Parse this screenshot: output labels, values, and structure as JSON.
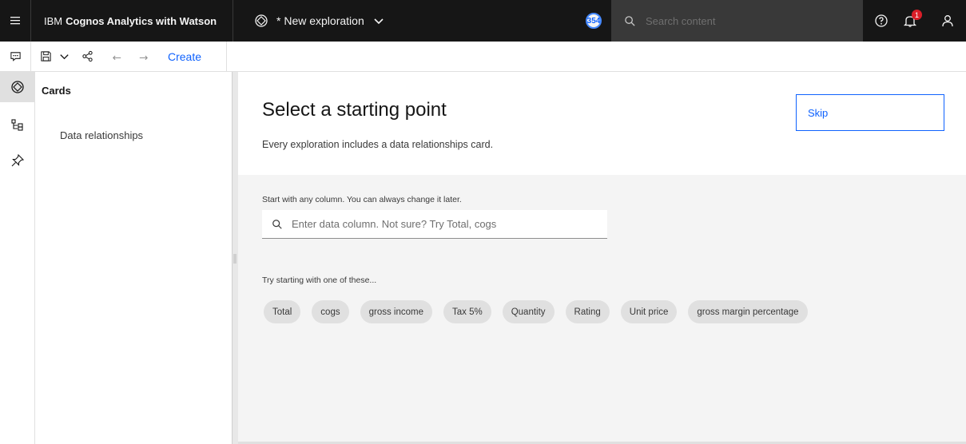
{
  "header": {
    "brand_prefix": "IBM",
    "brand_name": "Cognos Analytics with Watson",
    "exploration_title": "* New exploration",
    "badge_count": "354",
    "search_placeholder": "Search content",
    "notification_count": "1",
    "icons": [
      "menu-icon",
      "exploration-icon",
      "chevron-down-icon",
      "search-icon",
      "help-icon",
      "notification-icon",
      "user-icon"
    ]
  },
  "toolbar": {
    "create_label": "Create",
    "icons": [
      "comment-icon",
      "save-icon",
      "chevron-down-icon",
      "share-icon",
      "undo-icon",
      "redo-icon"
    ]
  },
  "rail": {
    "icons": [
      "exploration-icon",
      "data-relationships-icon",
      "pin-icon"
    ]
  },
  "panel": {
    "title": "Cards",
    "items": [
      {
        "label": "Data relationships"
      }
    ]
  },
  "main": {
    "title": "Select a starting point",
    "subtitle": "Every exploration includes a data relationships card.",
    "skip_label": "Skip",
    "hint": "Start with any column. You can always change it later.",
    "column_search_placeholder": "Enter data column. Not sure? Try Total, cogs",
    "try_label": "Try starting with one of these...",
    "chips": [
      "Total",
      "cogs",
      "gross income",
      "Tax 5%",
      "Quantity",
      "Rating",
      "Unit price",
      "gross margin percentage"
    ]
  },
  "colors": {
    "header_bg": "#161616",
    "accent": "#0f62fe",
    "body_bg": "#f4f4f4",
    "chip_bg": "#e0e0e0",
    "notification": "#da1e28"
  }
}
